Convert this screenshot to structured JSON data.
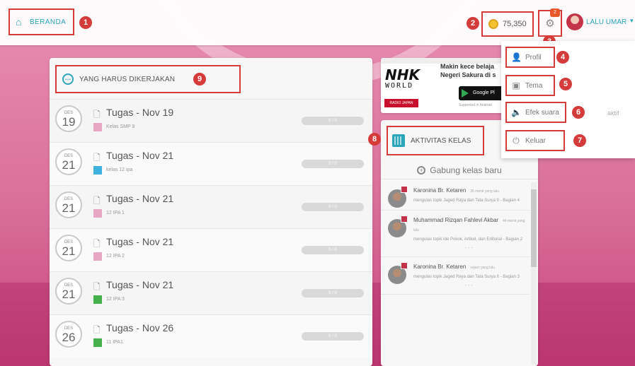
{
  "topbar": {
    "home_label": "BERANDA",
    "coins": "75,350",
    "notif_count": "2",
    "user_name": "LALU UMAR"
  },
  "markers": [
    "1",
    "2",
    "3",
    "4",
    "5",
    "6",
    "7",
    "8",
    "9"
  ],
  "tasks": {
    "title": "YANG HARUS DIKERJAKAN",
    "items": [
      {
        "month": "DES",
        "day": "19",
        "title": "Tugas - Nov 19",
        "class": "Kelas SMP 9",
        "color": "#e7a6c3",
        "progress": "0 / 0"
      },
      {
        "month": "DES",
        "day": "21",
        "title": "Tugas - Nov 21",
        "class": "kelas 12 ipa",
        "color": "#3fb2df",
        "progress": "0 / 0"
      },
      {
        "month": "DES",
        "day": "21",
        "title": "Tugas - Nov 21",
        "class": "12 IPA 1",
        "color": "#e7a6c3",
        "progress": "0 / 0"
      },
      {
        "month": "DES",
        "day": "21",
        "title": "Tugas - Nov 21",
        "class": "12 IPA 2",
        "color": "#e7a6c3",
        "progress": "0 / 0"
      },
      {
        "month": "DES",
        "day": "21",
        "title": "Tugas - Nov 21",
        "class": "12 IPA 3",
        "color": "#45b14a",
        "progress": "0 / 0"
      },
      {
        "month": "DES",
        "day": "26",
        "title": "Tugas - Nov 26",
        "class": "11 IPA1",
        "color": "#45b14a",
        "progress": "0 / 0"
      }
    ]
  },
  "banner": {
    "logo": "NHK",
    "world": "WORLD",
    "radio": "RADIO JAPAN",
    "headline_1": "Makin kece belaja",
    "headline_2": "Negeri Sakura di s",
    "button": "Google Pl",
    "small_text": "Supported in Android"
  },
  "activity": {
    "title": "AKTIVITAS KELAS",
    "join_label": "Gabung kelas baru",
    "feed": [
      {
        "name": "Karonina Br. Ketaren",
        "time": "35 menit yang lalu",
        "text": "mengulas topik Jaged Raya dan Tata Surya II - Bagian 4"
      },
      {
        "name": "Muhammad Rizqan Fahlevi Akbar",
        "time": "44 menit yang lalu",
        "text": "mengulas topik Ide Pokok, Artikel, dan Editorial - Bagian 2",
        "more": "···"
      },
      {
        "name": "Karonina Br. Ketaren",
        "time": "sejam yang lalu",
        "text": "mengulas topik Jaged Raya dan Tata Surya II - Bagian 3",
        "more": "···"
      }
    ]
  },
  "dropdown": {
    "items": [
      {
        "label": "Profil",
        "icon": "user-icon"
      },
      {
        "label": "Tema",
        "icon": "image-icon"
      },
      {
        "label": "Efek suara",
        "icon": "speaker-icon"
      },
      {
        "label": "Keluar",
        "icon": "power-icon"
      }
    ],
    "sound_status": "aktif"
  }
}
